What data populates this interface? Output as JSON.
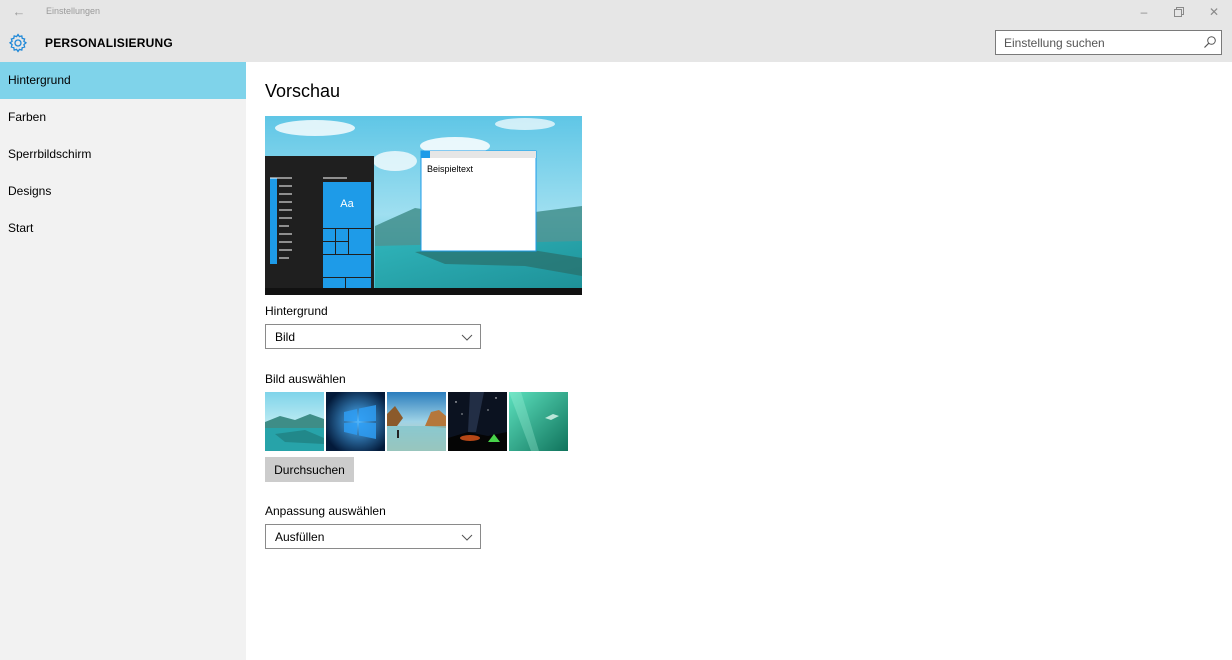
{
  "window": {
    "title": "Einstellungen",
    "back_icon": "back-arrow-icon",
    "controls": [
      "minimize-icon",
      "restore-icon",
      "close-icon"
    ]
  },
  "header": {
    "icon": "gear-icon",
    "title": "PERSONALISIERUNG",
    "search_placeholder": "Einstellung suchen"
  },
  "sidebar": {
    "items": [
      {
        "label": "Hintergrund",
        "active": true
      },
      {
        "label": "Farben",
        "active": false
      },
      {
        "label": "Sperrbildschirm",
        "active": false
      },
      {
        "label": "Designs",
        "active": false
      },
      {
        "label": "Start",
        "active": false
      }
    ],
    "active_color": "#7fd3ea"
  },
  "main": {
    "preview_title": "Vorschau",
    "preview": {
      "sample_text": "Beispieltext",
      "tile_text": "Aa",
      "accent_color": "#1e9be8"
    },
    "background_label": "Hintergrund",
    "background_value": "Bild",
    "choose_picture_label": "Bild auswählen",
    "thumbnails": [
      "lake-landscape",
      "windows-logo-blue",
      "beach-rocks",
      "night-sky-tent",
      "underwater-swimmer"
    ],
    "browse_label": "Durchsuchen",
    "fit_label": "Anpassung auswählen",
    "fit_value": "Ausfüllen"
  }
}
